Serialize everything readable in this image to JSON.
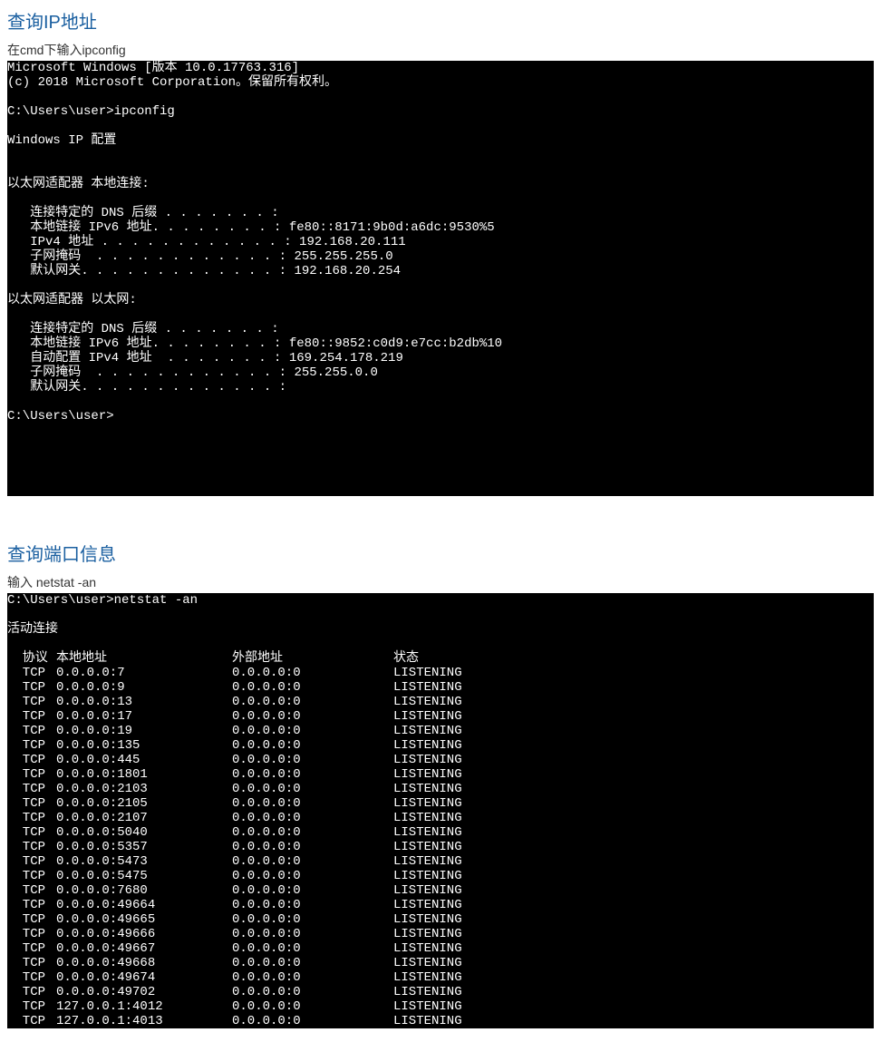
{
  "section1": {
    "title": "查询IP地址",
    "desc": "在cmd下输入ipconfig",
    "term": {
      "l0": "Microsoft Windows [版本 10.0.17763.316]",
      "l1": "(c) 2018 Microsoft Corporation。保留所有权利。",
      "l2": "",
      "l3": "C:\\Users\\user>ipconfig",
      "l4": "",
      "l5": "Windows IP 配置",
      "l6": "",
      "l7": "",
      "l8": "以太网适配器 本地连接:",
      "l9": "",
      "l10": "   连接特定的 DNS 后缀 . . . . . . . :",
      "l11": "   本地链接 IPv6 地址. . . . . . . . : fe80::8171:9b0d:a6dc:9530%5",
      "l12": "   IPv4 地址 . . . . . . . . . . . . : 192.168.20.111",
      "l13": "   子网掩码  . . . . . . . . . . . . : 255.255.255.0",
      "l14": "   默认网关. . . . . . . . . . . . . : 192.168.20.254",
      "l15": "",
      "l16": "以太网适配器 以太网:",
      "l17": "",
      "l18": "   连接特定的 DNS 后缀 . . . . . . . :",
      "l19": "   本地链接 IPv6 地址. . . . . . . . : fe80::9852:c0d9:e7cc:b2db%10",
      "l20": "   自动配置 IPv4 地址  . . . . . . . : 169.254.178.219",
      "l21": "   子网掩码  . . . . . . . . . . . . : 255.255.0.0",
      "l22": "   默认网关. . . . . . . . . . . . . :",
      "l23": "",
      "l24": "C:\\Users\\user>",
      "l25": "",
      "l26": "",
      "l27": "",
      "l28": "",
      "l29": ""
    }
  },
  "section2": {
    "title": "查询端口信息",
    "desc": "输入 netstat -an",
    "term": {
      "prompt": "C:\\Users\\user>netstat -an",
      "blank": "",
      "active": "活动连接",
      "header": {
        "proto": "  协议",
        "local": "本地地址",
        "foreign": "外部地址",
        "state": "状态"
      },
      "rows": [
        {
          "proto": "  TCP",
          "local": "0.0.0.0:7",
          "foreign": "0.0.0.0:0",
          "state": "LISTENING"
        },
        {
          "proto": "  TCP",
          "local": "0.0.0.0:9",
          "foreign": "0.0.0.0:0",
          "state": "LISTENING"
        },
        {
          "proto": "  TCP",
          "local": "0.0.0.0:13",
          "foreign": "0.0.0.0:0",
          "state": "LISTENING"
        },
        {
          "proto": "  TCP",
          "local": "0.0.0.0:17",
          "foreign": "0.0.0.0:0",
          "state": "LISTENING"
        },
        {
          "proto": "  TCP",
          "local": "0.0.0.0:19",
          "foreign": "0.0.0.0:0",
          "state": "LISTENING"
        },
        {
          "proto": "  TCP",
          "local": "0.0.0.0:135",
          "foreign": "0.0.0.0:0",
          "state": "LISTENING"
        },
        {
          "proto": "  TCP",
          "local": "0.0.0.0:445",
          "foreign": "0.0.0.0:0",
          "state": "LISTENING"
        },
        {
          "proto": "  TCP",
          "local": "0.0.0.0:1801",
          "foreign": "0.0.0.0:0",
          "state": "LISTENING"
        },
        {
          "proto": "  TCP",
          "local": "0.0.0.0:2103",
          "foreign": "0.0.0.0:0",
          "state": "LISTENING"
        },
        {
          "proto": "  TCP",
          "local": "0.0.0.0:2105",
          "foreign": "0.0.0.0:0",
          "state": "LISTENING"
        },
        {
          "proto": "  TCP",
          "local": "0.0.0.0:2107",
          "foreign": "0.0.0.0:0",
          "state": "LISTENING"
        },
        {
          "proto": "  TCP",
          "local": "0.0.0.0:5040",
          "foreign": "0.0.0.0:0",
          "state": "LISTENING"
        },
        {
          "proto": "  TCP",
          "local": "0.0.0.0:5357",
          "foreign": "0.0.0.0:0",
          "state": "LISTENING"
        },
        {
          "proto": "  TCP",
          "local": "0.0.0.0:5473",
          "foreign": "0.0.0.0:0",
          "state": "LISTENING"
        },
        {
          "proto": "  TCP",
          "local": "0.0.0.0:5475",
          "foreign": "0.0.0.0:0",
          "state": "LISTENING"
        },
        {
          "proto": "  TCP",
          "local": "0.0.0.0:7680",
          "foreign": "0.0.0.0:0",
          "state": "LISTENING"
        },
        {
          "proto": "  TCP",
          "local": "0.0.0.0:49664",
          "foreign": "0.0.0.0:0",
          "state": "LISTENING"
        },
        {
          "proto": "  TCP",
          "local": "0.0.0.0:49665",
          "foreign": "0.0.0.0:0",
          "state": "LISTENING"
        },
        {
          "proto": "  TCP",
          "local": "0.0.0.0:49666",
          "foreign": "0.0.0.0:0",
          "state": "LISTENING"
        },
        {
          "proto": "  TCP",
          "local": "0.0.0.0:49667",
          "foreign": "0.0.0.0:0",
          "state": "LISTENING"
        },
        {
          "proto": "  TCP",
          "local": "0.0.0.0:49668",
          "foreign": "0.0.0.0:0",
          "state": "LISTENING"
        },
        {
          "proto": "  TCP",
          "local": "0.0.0.0:49674",
          "foreign": "0.0.0.0:0",
          "state": "LISTENING"
        },
        {
          "proto": "  TCP",
          "local": "0.0.0.0:49702",
          "foreign": "0.0.0.0:0",
          "state": "LISTENING"
        },
        {
          "proto": "  TCP",
          "local": "127.0.0.1:4012",
          "foreign": "0.0.0.0:0",
          "state": "LISTENING"
        },
        {
          "proto": "  TCP",
          "local": "127.0.0.1:4013",
          "foreign": "0.0.0.0:0",
          "state": "LISTENING"
        }
      ]
    }
  }
}
